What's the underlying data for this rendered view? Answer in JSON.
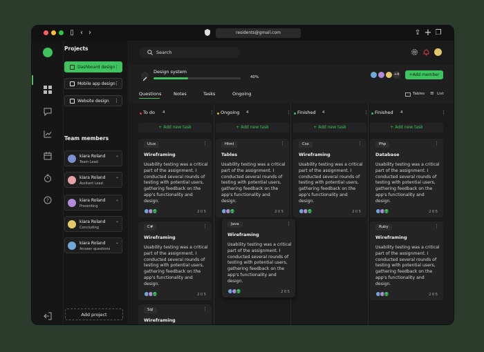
{
  "browser": {
    "url": "residents@gmail.com"
  },
  "sidebar": {
    "projects_title": "Projects",
    "projects": [
      {
        "label": "Dashboard design"
      },
      {
        "label": "Mobile app design"
      },
      {
        "label": "Website design"
      }
    ],
    "team_title": "Team members",
    "members": [
      {
        "name": "kiara Roland",
        "role": "Team Lead"
      },
      {
        "name": "kiara Roland",
        "role": "Assitant Lead"
      },
      {
        "name": "kiara Roland",
        "role": "Presenting"
      },
      {
        "name": "kiara Roland",
        "role": "Concluding"
      },
      {
        "name": "kiara Roland",
        "role": "Answer questions"
      }
    ],
    "add_project": "Add project"
  },
  "search": {
    "placeholder": "Search"
  },
  "project": {
    "title": "Design system",
    "progress_label": "40%",
    "progress": 0.4,
    "member_count": "+4",
    "add_member": "+Add member"
  },
  "tabs": [
    "Questions",
    "Notes",
    "Tasks",
    "Ongoing"
  ],
  "view": {
    "tables": "Tables",
    "list": "List"
  },
  "add_task_label": "+ Add new task",
  "columns": [
    {
      "title": "To do",
      "count": "4",
      "color": "#e23c3c"
    },
    {
      "title": "Ongoing",
      "count": "4",
      "color": "#d9b23a"
    },
    {
      "title": "Finished",
      "count": "4",
      "color": "#3ec45e"
    },
    {
      "title": "Finished",
      "count": "4",
      "color": "#3ec45e"
    }
  ],
  "cards": [
    {
      "tag": "Uiux",
      "title": "Wireframing",
      "desc": "Usability testing was a critical part of the assignment. I conducted several rounds of testing with potential users, gathering feedback on the app's functionality and design.",
      "avatar_count": "+4",
      "stats": "2   0   5"
    },
    {
      "tag": "Html",
      "title": "Tables",
      "desc": "Usability testing was a critical part of the assignment. I conducted several rounds of testing with potential users, gathering feedback on the app's functionality and design.",
      "avatar_count": "+4",
      "stats": "2   0   5"
    },
    {
      "tag": "Css",
      "title": "Wireframing",
      "desc": "Usability testing was a critical part of the assignment. I conducted several rounds of testing with potential users, gathering feedback on the app's functionality and design.",
      "avatar_count": "+4",
      "stats": "2   0   5"
    },
    {
      "tag": "Php",
      "title": "Database",
      "desc": "Usability testing was a critical part of the assignment. I conducted several rounds of testing with potential users, gathering feedback on the app's functionality and design.",
      "avatar_count": "+4",
      "stats": "2   0   5"
    },
    {
      "tag": "C#",
      "title": "Wireframing",
      "desc": "Usability testing was a critical part of the assignment. I conducted several rounds of testing with potential users, gathering feedback on the app's functionality and design.",
      "avatar_count": "+4",
      "stats": "2   0   5"
    },
    {
      "tag": "Java",
      "title": "Wireframing",
      "desc": "Usability testing was a critical part of the assignment. I conducted several rounds of testing with potential users, gathering feedback on the app's functionality and design.",
      "avatar_count": "+4",
      "stats": "2   0   5"
    },
    {
      "tag": "Ruby",
      "title": "Wireframing",
      "desc": "Usability testing was a critical part of the assignment. I conducted several rounds of testing with potential users, gathering feedback on the app's functionality and design.",
      "avatar_count": "+4",
      "stats": "2   0   5"
    },
    {
      "tag": "Sql",
      "title": "Wireframing"
    }
  ],
  "colors": {
    "accent": "#3ec45e",
    "bg": "#1a1a1a",
    "card": "#242424"
  }
}
